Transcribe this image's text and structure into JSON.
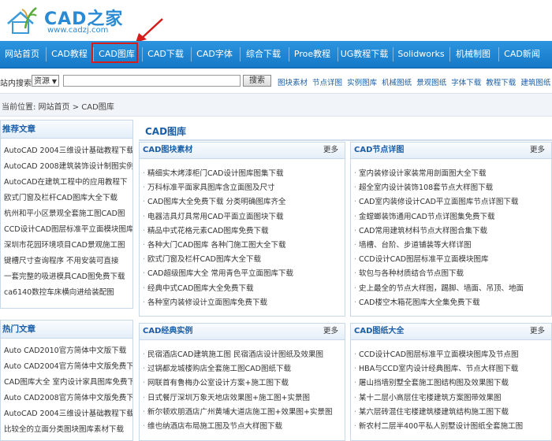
{
  "logo": {
    "title": "CAD之家",
    "url": "www.cadzj.com"
  },
  "nav": {
    "items": [
      "网站首页",
      "CAD教程",
      "CAD图库",
      "CAD下载",
      "CAD字体",
      "综合下载",
      "Proe教程",
      "UG教程下载",
      "Solidworks",
      "机械制图",
      "CAD新闻"
    ],
    "active_index": 2
  },
  "search": {
    "label": "站内搜索:",
    "select_value": "资源",
    "input_value": "",
    "button_label": "搜索",
    "quick_links": [
      "图块素材",
      "节点详图",
      "实例图库",
      "机械图纸",
      "景观图纸",
      "字体下载",
      "教程下载",
      "建筑图纸"
    ]
  },
  "breadcrumb": "当前位置: 网站首页 > CAD图库",
  "sidebar": {
    "recommended": {
      "title": "推荐文章",
      "items": [
        "AutoCAD 2004三维设计基础教程下载",
        "AutoCAD 2008建筑装饰设计制图实例",
        "AutoCAD在建筑工程中的应用教程下",
        "欧式门窗及栏杆CAD图库大全下载",
        "杭州和平小区景观全套施工图CAD图",
        "CCD设计CAD图层标准平立面模块图库",
        "深圳市花园环境项目CAD景观施工图",
        "键槽尺寸查询程序 不用安装可直接",
        "一套完整的吸进模具CAD图免费下载",
        "ca6140数控车床横向进给装配图"
      ]
    },
    "hot": {
      "title": "热门文章",
      "items": [
        "Auto CAD2010官方简体中文版下载",
        "Auto CAD2004官方简体中文版免费下",
        "CAD图库大全 室内设计家具图库免费下",
        "Auto CAD2008官方简体中文版免费下",
        "AutoCAD 2004三维设计基础教程下载",
        "比较全的立面分类图块图库素材下载"
      ]
    }
  },
  "main": {
    "title": "CAD图库",
    "more_label": "更多",
    "panels": [
      {
        "title": "CAD图块素材",
        "items": [
          "精细实木烤漆柜门CAD设计图库图集下载",
          "万科标准平面家具图库含立面图及尺寸",
          "CAD图库大全免费下载 分类明确图库齐全",
          "电器洁具灯具常用CAD平面立面图块下载",
          "精品中式花格元素CAD图库免费下载",
          "各种大门CAD图库 各种门施工图大全下载",
          "欧式门窗及栏杆CAD图库大全下载",
          "CAD超级图库大全 常用青色平立面图库下载",
          "经典中式CAD图库大全免费下载",
          "各种室内装修设计立面图库免费下载"
        ]
      },
      {
        "title": "CAD节点详图",
        "items": [
          "室内装修设计家装常用剖面图大全下载",
          "超全室内设计装饰108套节点大样图下载",
          "CAD室内装修设计CAD平立面图库节点详图下载",
          "金螳螂装饰通用CAD节点详图集免费下载",
          "CAD常用建筑材料节点大样图合集下载",
          "墙槽、台阶、步道铺装等大样详图",
          "CCD设计CAD图层标准平立面模块图库",
          "软包与各种材质结合节点图下载",
          "史上最全的节点大样图，踢脚、墙面、吊顶、地面",
          "CAD楼空木箱花图库大全集免费下载"
        ]
      },
      {
        "title": "CAD经典实例",
        "items": [
          "民宿酒店CAD建筑施工图 民宿酒店设计图纸及效果图",
          "过锅都龙城楼购店全套施工图CAD图纸下载",
          "网联首有鲁梅办公室设计方案+施工图下载",
          "日式餐厅深圳万象天地店效果图+施工图+实景图",
          "新尔顿欢朋酒店广州黄埔大道店施工图+效果图+实景图",
          "维也纳酒店布局施工图及节点大样图下载"
        ]
      },
      {
        "title": "CAD图纸大全",
        "items": [
          "CCD设计CAD图层标准平立面模块图库及节点图",
          "HBA与CCD室内设计经典图库、节点大样图下载",
          "屠山挡墙别墅全套施工图结构图及效果图下载",
          "某十二层小高层住宅楼建筑方案图带效果图",
          "某六层砖混住宅楼建筑楼建筑结构施工图下载",
          "新农村二层半400平私人别墅设计图纸全套施工图"
        ]
      }
    ]
  }
}
